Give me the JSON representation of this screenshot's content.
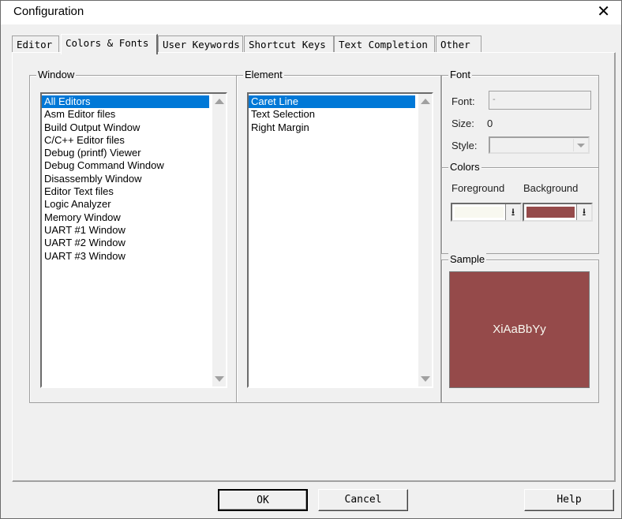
{
  "window": {
    "title": "Configuration",
    "close_glyph": "✕"
  },
  "tabs": [
    {
      "label": "Editor",
      "active": false
    },
    {
      "label": "Colors & Fonts",
      "active": true
    },
    {
      "label": "User Keywords",
      "active": false
    },
    {
      "label": "Shortcut Keys",
      "active": false
    },
    {
      "label": "Text Completion",
      "active": false
    },
    {
      "label": "Other",
      "active": false
    }
  ],
  "window_group": {
    "label": "Window",
    "items": [
      "All Editors",
      "Asm Editor files",
      "Build Output Window",
      "C/C++ Editor files",
      "Debug (printf) Viewer",
      "Debug Command Window",
      "Disassembly Window",
      "Editor Text files",
      "Logic Analyzer",
      "Memory Window",
      "UART #1 Window",
      "UART #2 Window",
      "UART #3 Window"
    ],
    "selected": "All Editors"
  },
  "element_group": {
    "label": "Element",
    "items": [
      "Caret Line",
      "Text Selection",
      "Right Margin"
    ],
    "selected": "Caret Line"
  },
  "font_group": {
    "label": "Font",
    "font_label": "Font:",
    "font_value": "-",
    "size_label": "Size:",
    "size_value": "0",
    "style_label": "Style:",
    "style_value": ""
  },
  "colors_group": {
    "label": "Colors",
    "foreground_label": "Foreground",
    "background_label": "Background",
    "foreground_color": "#f8f8f0",
    "background_color": "#954a4a",
    "dropdown_glyph": "⭳"
  },
  "sample_group": {
    "label": "Sample",
    "text": "XiAaBbYy"
  },
  "buttons": {
    "ok": "OK",
    "cancel": "Cancel",
    "help": "Help"
  }
}
